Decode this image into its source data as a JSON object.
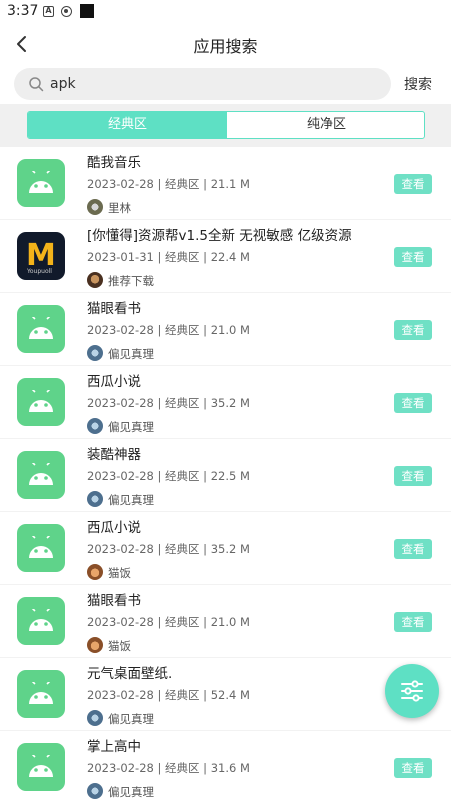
{
  "status_bar": {
    "time": "3:37",
    "icon_a": "A"
  },
  "header": {
    "title": "应用搜索"
  },
  "search": {
    "value": "apk",
    "button_label": "搜索"
  },
  "tabs": [
    {
      "label": "经典区",
      "active": true
    },
    {
      "label": "纯净区",
      "active": false
    }
  ],
  "results": [
    {
      "name": "酷我音乐",
      "meta": "2023-02-28 | 经典区 | 21.1 M",
      "author": "里林",
      "icon": "android-icon",
      "action": "查看"
    },
    {
      "name": "[你懂得]资源帮v1.5全新 无视敏感 亿级资源",
      "meta": "2023-01-31 | 经典区 | 22.4 M",
      "author": "推荐下载",
      "icon": "mi-logo-icon",
      "action": "查看"
    },
    {
      "name": "猫眼看书",
      "meta": "2023-02-28 | 经典区 | 21.0 M",
      "author": "偏见真理",
      "icon": "android-icon",
      "action": "查看"
    },
    {
      "name": "西瓜小说",
      "meta": "2023-02-28 | 经典区 | 35.2 M",
      "author": "偏见真理",
      "icon": "android-icon",
      "action": "查看"
    },
    {
      "name": "装酷神器",
      "meta": "2023-02-28 | 经典区 | 22.5 M",
      "author": "偏见真理",
      "icon": "android-icon",
      "action": "查看"
    },
    {
      "name": "西瓜小说",
      "meta": "2023-02-28 | 经典区 | 35.2 M",
      "author": "猫饭",
      "icon": "android-icon",
      "action": "查看"
    },
    {
      "name": "猫眼看书",
      "meta": "2023-02-28 | 经典区 | 21.0 M",
      "author": "猫饭",
      "icon": "android-icon",
      "action": "查看"
    },
    {
      "name": "元气桌面壁纸.",
      "meta": "2023-02-28 | 经典区 | 52.4 M",
      "author": "偏见真理",
      "icon": "android-icon",
      "action": "查看"
    },
    {
      "name": "掌上高中",
      "meta": "2023-02-28 | 经典区 | 31.6 M",
      "author": "偏见真理",
      "icon": "android-icon",
      "action": "查看"
    }
  ],
  "mi_icon_caption": "Youpuoll",
  "colors": {
    "accent": "#5ee0c4",
    "android_icon": "#5fd38a"
  },
  "fab": {
    "icon": "filter-sliders-icon"
  }
}
